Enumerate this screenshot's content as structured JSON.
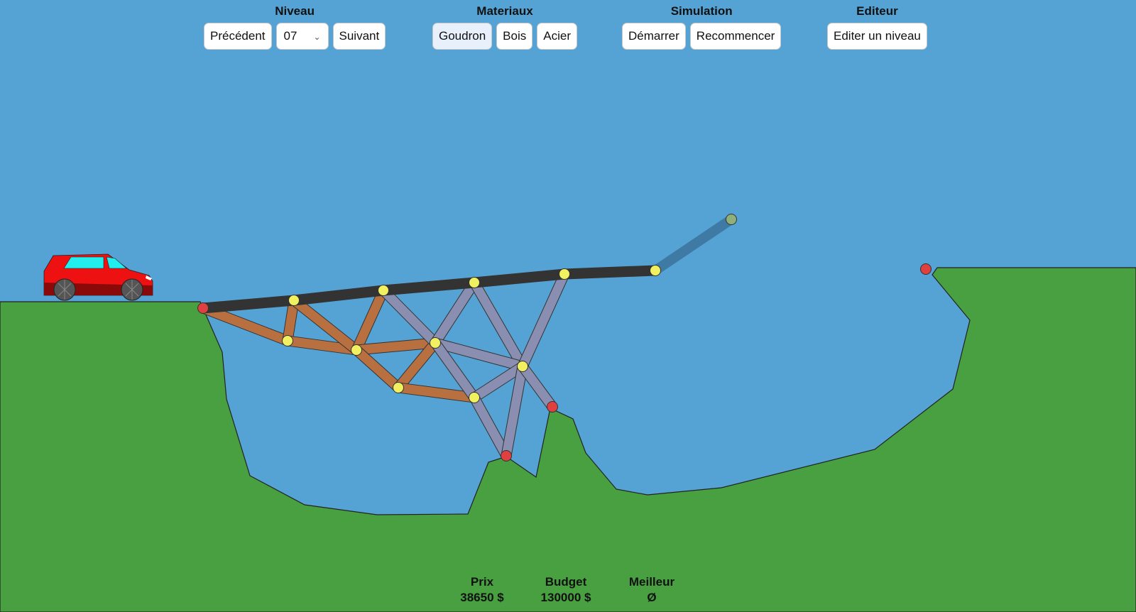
{
  "toolbar": {
    "niveau": {
      "title": "Niveau",
      "prev_label": "Précédent",
      "level_value": "07",
      "next_label": "Suivant"
    },
    "materiaux": {
      "title": "Materiaux",
      "items": [
        "Goudron",
        "Bois",
        "Acier"
      ],
      "selected": "Goudron"
    },
    "simulation": {
      "title": "Simulation",
      "start_label": "Démarrer",
      "restart_label": "Recommencer"
    },
    "editeur": {
      "title": "Editeur",
      "edit_label": "Editer un niveau"
    }
  },
  "stats": {
    "prix": {
      "label": "Prix",
      "value": "38650 $"
    },
    "budget": {
      "label": "Budget",
      "value": "130000 $"
    },
    "meilleur": {
      "label": "Meilleur",
      "value": "Ø"
    }
  },
  "colors": {
    "sky": "#55a3d4",
    "ground": "#48a041",
    "road": "#333333",
    "wood": "#b87040",
    "steel": "#8a8eb0",
    "joint": "#f0f060",
    "anchor": "#e04040",
    "car_body": "#ee1111",
    "car_window": "#22eeee"
  }
}
